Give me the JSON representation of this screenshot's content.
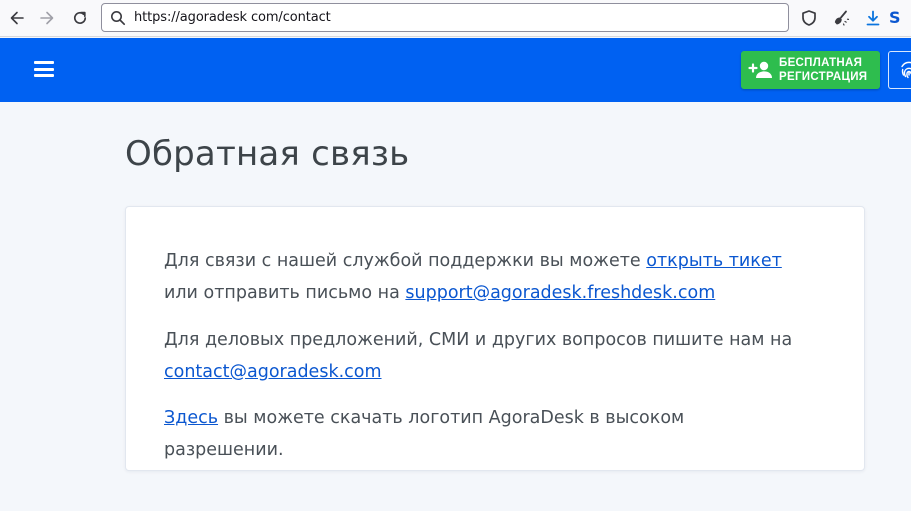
{
  "browser": {
    "url": "https://agoradesk com/contact",
    "extension_label": "S"
  },
  "header": {
    "signup_label_line1": "БЕСПЛАТНАЯ",
    "signup_label_line2": "РЕГИСТРАЦИЯ"
  },
  "page": {
    "title": "Обратная связь"
  },
  "support": {
    "text1": "Для связи с нашей службой поддержки вы можете ",
    "ticket_link": "открыть тикет",
    "text2": " или отправить письмо на ",
    "email_link": "support@agoradesk.freshdesk.com"
  },
  "business": {
    "text": "Для деловых предложений, СМИ и других вопросов пишите нам на ",
    "email_link": "contact@agoradesk.com"
  },
  "logo": {
    "link": "Здесь",
    "text": " вы можете скачать логотип AgoraDesk в высоком разрешении."
  },
  "colors": {
    "header_bg": "#0061f2",
    "signup_bg": "#2ebd4e",
    "link": "#0b57d0",
    "page_bg": "#f4f7fb"
  }
}
